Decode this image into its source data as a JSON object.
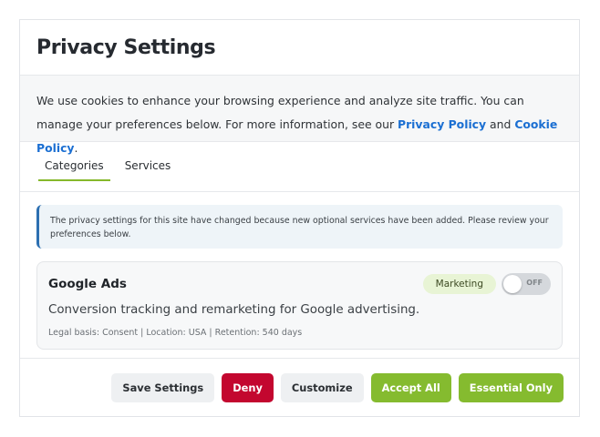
{
  "dialog": {
    "title": "Privacy Settings",
    "intro": {
      "text_before": "We use cookies to enhance your browsing experience and analyze site traffic. You can manage your preferences below. For more information, see our ",
      "privacy_link": "Privacy Policy",
      "and": " and ",
      "cookie_link": "Cookie Policy",
      "text_after": "."
    },
    "tabs": [
      {
        "label": "Categories",
        "active": true
      },
      {
        "label": "Services",
        "active": false
      }
    ],
    "notice": "The privacy settings for this site have changed because new optional services have been added. Please review your preferences below.",
    "service": {
      "name": "Google Ads",
      "category": "Marketing",
      "toggle_state": "OFF",
      "description": "Conversion tracking and remarketing for Google advertising.",
      "meta": "Legal basis: Consent | Location: USA | Retention: 540 days"
    },
    "buttons": {
      "save": "Save Settings",
      "deny": "Deny",
      "customize": "Customize",
      "accept_all": "Accept All",
      "essential_only": "Essential Only"
    }
  },
  "colors": {
    "accent_green": "#85bb2f",
    "deny_red": "#c3072f",
    "link_blue": "#1b6fd2",
    "notice_border": "#2c6fb1"
  }
}
